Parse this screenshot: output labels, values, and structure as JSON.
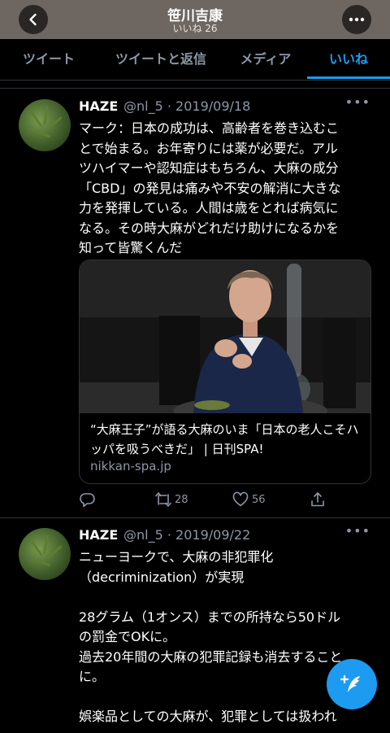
{
  "header": {
    "title": "笹川吉康",
    "subtitle": "いいね 26"
  },
  "tabs": [
    {
      "label": "ツイート"
    },
    {
      "label": "ツイートと返信"
    },
    {
      "label": "メディア"
    },
    {
      "label": "いいね"
    }
  ],
  "tweets": [
    {
      "name": "HAZE",
      "handle_date": "@nl_5 · 2019/09/18",
      "text_lines": [
        "マーク：日本の成功は、高齢者を巻き込むこ",
        "とで始まる。お年寄りには薬が必要だ。アル",
        "ツハイマーや認知症はもちろん、大麻の成分",
        "「CBD」の発見は痛みや不安の解消に大きな",
        "力を発揮している。人間は歳をとれば病気に",
        "なる。その時大麻がどれだけ助けになるかを",
        "知って皆驚くんだ"
      ],
      "card": {
        "title": "“大麻王子”が語る大麻のいま「日本の老人こそハッパを吸うべきだ」 | 日刊SPA!",
        "url": "nikkan-spa.jp"
      },
      "retweets": "28",
      "likes": "56"
    },
    {
      "name": "HAZE",
      "handle_date": "@nl_5 · 2019/09/22",
      "text_lines": [
        "ニューヨークで、大麻の非犯罪化",
        "（decriminization）が実現",
        "",
        "28グラム（1オンス）までの所持なら50ドル",
        "の罰金でOKに。",
        "過去20年間の大麻の犯罪記録も消去すること",
        "に。",
        "",
        "娯楽品としての大麻が、犯罪としては扱われ"
      ]
    }
  ],
  "icons": {
    "back": "chevron-left-icon",
    "more": "more-icon",
    "reply": "reply-icon",
    "retweet": "retweet-icon",
    "like": "heart-icon",
    "share": "share-icon",
    "compose": "compose-tweet-icon"
  },
  "colors": {
    "accent": "#1d9bf0",
    "background": "#000000",
    "secondary_text": "#8b98a5"
  }
}
